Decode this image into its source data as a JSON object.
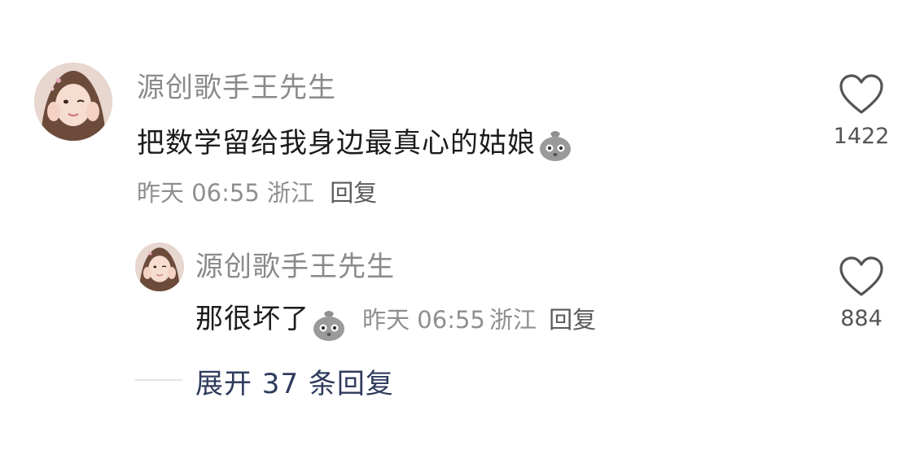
{
  "comment": {
    "username": "源创歌手王先生",
    "text": "把数学留给我身边最真心的姑娘",
    "emoji": "bag-face-emoji",
    "time": "昨天 06:55",
    "location": "浙江",
    "reply_label": "回复",
    "likes": "1422"
  },
  "reply": {
    "username": "源创歌手王先生",
    "text": "那很坏了",
    "emoji": "bag-face-emoji",
    "time": "昨天 06:55",
    "location": "浙江",
    "reply_label": "回复",
    "likes": "884"
  },
  "expand": {
    "label": "展开 37 条回复"
  },
  "colors": {
    "username": "#8a8a8a",
    "text": "#1c1c1c",
    "meta": "#8f8f8f",
    "expand": "#2f3b5c"
  }
}
